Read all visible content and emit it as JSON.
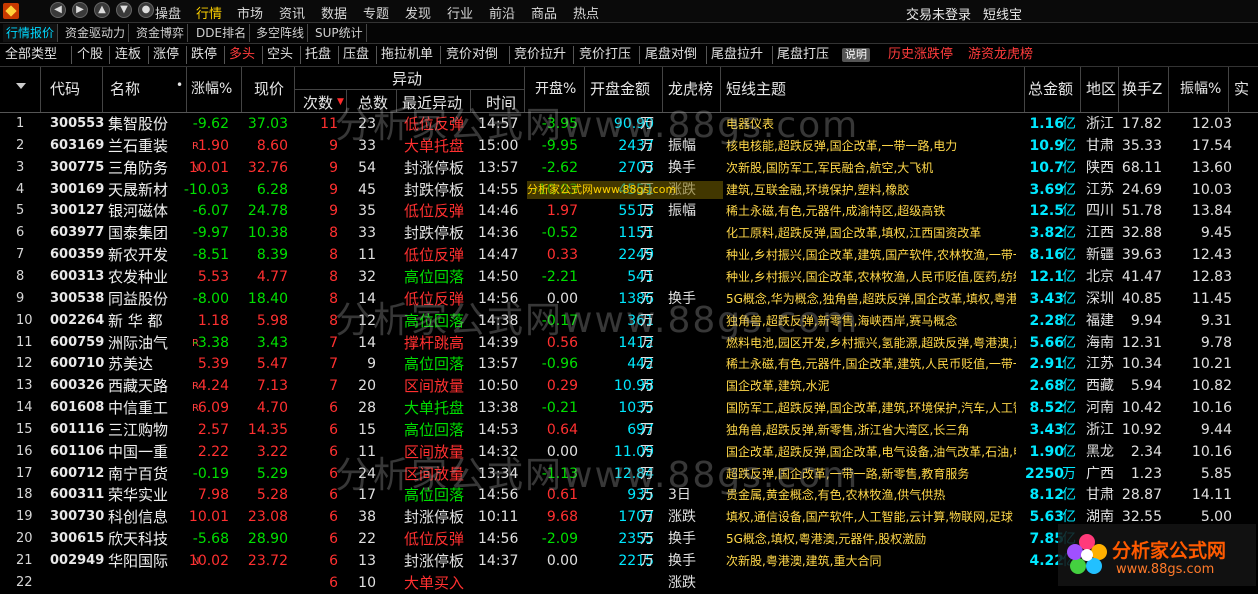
{
  "topbar": {
    "menus": [
      "操盘",
      "行情",
      "市场",
      "资讯",
      "数据",
      "专题",
      "发现",
      "行业",
      "前沿",
      "商品",
      "热点"
    ],
    "active_menu": "行情",
    "login": "交易未登录",
    "brand": "短线宝"
  },
  "tabs1": [
    "行情报价",
    "资金驱动力",
    "资金博弈",
    "DDE排名",
    "多空阵线",
    "SUP统计"
  ],
  "tabs2": [
    "全部类型",
    "个股",
    "连板",
    "涨停",
    "跌停",
    "多头",
    "空头",
    "托盘",
    "压盘",
    "拖拉机单",
    "竞价对倒",
    "竞价拉升",
    "竞价打压",
    "尾盘对倒",
    "尾盘拉升",
    "尾盘打压",
    "说明",
    "历史涨跌停",
    "游资龙虎榜"
  ],
  "columns": {
    "code": "代码",
    "name": "名称",
    "chg": "涨幅%",
    "price": "现价",
    "group": "异动",
    "times": "次数",
    "total": "总数",
    "recent": "最近异动",
    "time": "时间",
    "open": "开盘%",
    "open_amt": "开盘金额",
    "lhb": "龙虎榜",
    "theme": "短线主题",
    "total_amt": "总金额",
    "region": "地区",
    "turnover": "换手Z",
    "amplitude": "振幅%",
    "extra": "实"
  },
  "rows": [
    [
      "1",
      "300553",
      "集智股份",
      "",
      "-9.62",
      "37.03",
      "11",
      "23",
      "低位反弹",
      "14:57",
      "-3.95",
      "90.90",
      "万",
      "",
      "电器仪表",
      "1.16",
      "亿",
      "浙江",
      "17.82",
      "12.03",
      "down",
      "down",
      "red"
    ],
    [
      "2",
      "603169",
      "兰石重装",
      "R",
      "1.90",
      "8.60",
      "9",
      "33",
      "大单托盘",
      "15:00",
      "-9.95",
      "2437",
      "万",
      "振幅",
      "核电核能,超跌反弹,国企改革,一带一路,电力",
      "10.9",
      "亿",
      "甘肃",
      "35.33",
      "17.54",
      "up",
      "down",
      "red"
    ],
    [
      "3",
      "300775",
      "三角防务",
      "N",
      "10.01",
      "32.76",
      "9",
      "54",
      "封涨停板",
      "13:57",
      "-2.62",
      "2703",
      "万",
      "换手",
      "次新股,国防军工,军民融合,航空,大飞机",
      "10.7",
      "亿",
      "陕西",
      "68.11",
      "13.60",
      "up",
      "down",
      "white"
    ],
    [
      "4",
      "300169",
      "天晟新材",
      "",
      "-10.03",
      "6.28",
      "9",
      "45",
      "封跌停板",
      "14:55",
      "-10.03",
      "4551",
      "万",
      "涨跌",
      "建筑,互联金融,环境保护,塑料,橡胶",
      "3.69",
      "亿",
      "江苏",
      "24.69",
      "10.03",
      "down",
      "down",
      "white"
    ],
    [
      "5",
      "300127",
      "银河磁体",
      "",
      "-6.07",
      "24.78",
      "9",
      "35",
      "低位反弹",
      "14:46",
      "1.97",
      "5513",
      "万",
      "振幅",
      "稀土永磁,有色,元器件,成渝特区,超级高铁",
      "12.5",
      "亿",
      "四川",
      "51.78",
      "13.84",
      "down",
      "up",
      "red"
    ],
    [
      "6",
      "603977",
      "国泰集团",
      "",
      "-9.97",
      "10.38",
      "8",
      "33",
      "封跌停板",
      "14:36",
      "-0.52",
      "1151",
      "万",
      "",
      "化工原料,超跌反弹,国企改革,填权,江西国资改革",
      "3.82",
      "亿",
      "江西",
      "32.88",
      "9.45",
      "down",
      "down",
      "white"
    ],
    [
      "7",
      "600359",
      "新农开发",
      "",
      "-8.51",
      "8.39",
      "8",
      "11",
      "低位反弹",
      "14:47",
      "0.33",
      "2249",
      "万",
      "",
      "种业,乡村振兴,国企改革,建筑,国产软件,农林牧渔,一带一",
      "8.16",
      "亿",
      "新疆",
      "39.63",
      "12.43",
      "down",
      "up",
      "red"
    ],
    [
      "8",
      "600313",
      "农发种业",
      "",
      "5.53",
      "4.77",
      "8",
      "32",
      "高位回落",
      "14:50",
      "-2.21",
      "541",
      "万",
      "",
      "种业,乡村振兴,国企改革,农林牧渔,人民币贬值,医药,纺织",
      "12.1",
      "亿",
      "北京",
      "41.47",
      "12.83",
      "up",
      "down",
      "green"
    ],
    [
      "9",
      "300538",
      "同益股份",
      "",
      "-8.00",
      "18.40",
      "8",
      "14",
      "低位反弹",
      "14:56",
      "0.00",
      "1386",
      "万",
      "换手",
      "5G概念,华为概念,独角兽,超跌反弹,国企改革,填权,粤港澳",
      "3.43",
      "亿",
      "深圳",
      "40.85",
      "11.45",
      "down",
      "flat",
      "red"
    ],
    [
      "10",
      "002264",
      "新 华 都",
      "",
      "1.18",
      "5.98",
      "8",
      "12",
      "高位回落",
      "14:38",
      "-0.17",
      "361",
      "万",
      "",
      "独角兽,超跌反弹,新零售,海峡西岸,赛马概念",
      "2.28",
      "亿",
      "福建",
      "9.94",
      "9.31",
      "up",
      "down",
      "green"
    ],
    [
      "11",
      "600759",
      "洲际油气",
      "R",
      "-3.38",
      "3.43",
      "7",
      "14",
      "撑杆跳高",
      "14:39",
      "0.56",
      "1412",
      "万",
      "",
      "燃料电池,园区开发,乡村振兴,氢能源,超跌反弹,粤港澳,页岩",
      "5.66",
      "亿",
      "海南",
      "12.31",
      "9.78",
      "down",
      "up",
      "red"
    ],
    [
      "12",
      "600710",
      "苏美达",
      "",
      "5.39",
      "5.47",
      "7",
      "9",
      "高位回落",
      "13:57",
      "-0.96",
      "442",
      "万",
      "",
      "稀土永磁,有色,元器件,国企改革,建筑,人民币贬值,一带一",
      "2.91",
      "亿",
      "江苏",
      "10.34",
      "10.21",
      "up",
      "down",
      "green"
    ],
    [
      "13",
      "600326",
      "西藏天路",
      "R",
      "4.24",
      "7.13",
      "7",
      "20",
      "区间放量",
      "10:50",
      "0.29",
      "10.98",
      "万",
      "",
      "国企改革,建筑,水泥",
      "2.68",
      "亿",
      "西藏",
      "5.94",
      "10.82",
      "up",
      "up",
      "red"
    ],
    [
      "14",
      "601608",
      "中信重工",
      "R",
      "6.09",
      "4.70",
      "6",
      "28",
      "大单托盘",
      "13:38",
      "-0.21",
      "1035",
      "万",
      "",
      "国防军工,超跌反弹,国企改革,建筑,环境保护,汽车,人工智",
      "8.52",
      "亿",
      "河南",
      "10.42",
      "10.16",
      "up",
      "down",
      "green"
    ],
    [
      "15",
      "601116",
      "三江购物",
      "",
      "2.57",
      "14.35",
      "6",
      "15",
      "高位回落",
      "14:53",
      "0.64",
      "697",
      "万",
      "",
      "独角兽,超跌反弹,新零售,浙江省大湾区,长三角",
      "3.43",
      "亿",
      "浙江",
      "10.92",
      "9.44",
      "up",
      "up",
      "green"
    ],
    [
      "16",
      "601106",
      "中国一重",
      "",
      "2.22",
      "3.22",
      "6",
      "11",
      "区间放量",
      "14:32",
      "0.00",
      "11.09",
      "万",
      "",
      "国企改革,超跌反弹,国企改革,电气设备,油气改革,石油,电",
      "1.90",
      "亿",
      "黑龙",
      "2.34",
      "10.16",
      "up",
      "flat",
      "red"
    ],
    [
      "17",
      "600712",
      "南宁百货",
      "",
      "-0.19",
      "5.29",
      "6",
      "24",
      "区间放量",
      "13:34",
      "-1.13",
      "12.84",
      "万",
      "",
      "超跌反弹,国企改革,一带一路,新零售,教育服务",
      "2250",
      "万",
      "广西",
      "1.23",
      "5.85",
      "down",
      "down",
      "red"
    ],
    [
      "18",
      "600311",
      "荣华实业",
      "",
      "7.98",
      "5.28",
      "6",
      "17",
      "高位回落",
      "14:56",
      "0.61",
      "935",
      "万",
      "3日",
      "贵金属,黄金概念,有色,农林牧渔,供气供热",
      "8.12",
      "亿",
      "甘肃",
      "28.87",
      "14.11",
      "up",
      "up",
      "green"
    ],
    [
      "19",
      "300730",
      "科创信息",
      "",
      "10.01",
      "23.08",
      "6",
      "38",
      "封涨停板",
      "10:11",
      "9.68",
      "1707",
      "万",
      "涨跌",
      "填权,通信设备,国产软件,人工智能,云计算,物联网,足球",
      "5.63",
      "亿",
      "湖南",
      "32.55",
      "5.00",
      "up",
      "up",
      "white"
    ],
    [
      "20",
      "300615",
      "欣天科技",
      "",
      "-5.68",
      "28.90",
      "6",
      "22",
      "低位反弹",
      "14:56",
      "-2.09",
      "2355",
      "万",
      "换手",
      "5G概念,填权,粤港澳,元器件,股权激励",
      "7.85",
      "亿",
      "",
      "",
      "",
      "down",
      "down",
      "red"
    ],
    [
      "21",
      "002949",
      "华阳国际",
      "N",
      "10.02",
      "23.72",
      "6",
      "13",
      "封涨停板",
      "14:37",
      "0.00",
      "2215",
      "万",
      "换手",
      "次新股,粤港澳,建筑,重大合同",
      "4.22",
      "亿",
      "",
      "",
      "",
      "up",
      "flat",
      "white"
    ]
  ],
  "partial_row": [
    "22",
    "",
    "",
    "",
    "",
    "",
    "6",
    "10",
    "大单买入",
    "",
    "",
    "",
    "",
    "涨跌",
    "",
    "",
    "",
    "",
    "",
    "",
    "up",
    "up",
    "red"
  ],
  "watermarks": [
    "分析家公式网www.88gs.com",
    "分析家公式网www.88gs.com",
    "分析家公式网www.88gs.com"
  ],
  "tooltip": "分析家公式网www.88gs.com",
  "brand": {
    "title": "分析家公式网",
    "url": "www.88gs.com"
  },
  "colors": {
    "up": "#ff3030",
    "down": "#00e000",
    "amount": "#00e8ff",
    "theme": "#ffd84a",
    "active_tab": "#00d8ff",
    "active_menu": "#ffd200"
  }
}
